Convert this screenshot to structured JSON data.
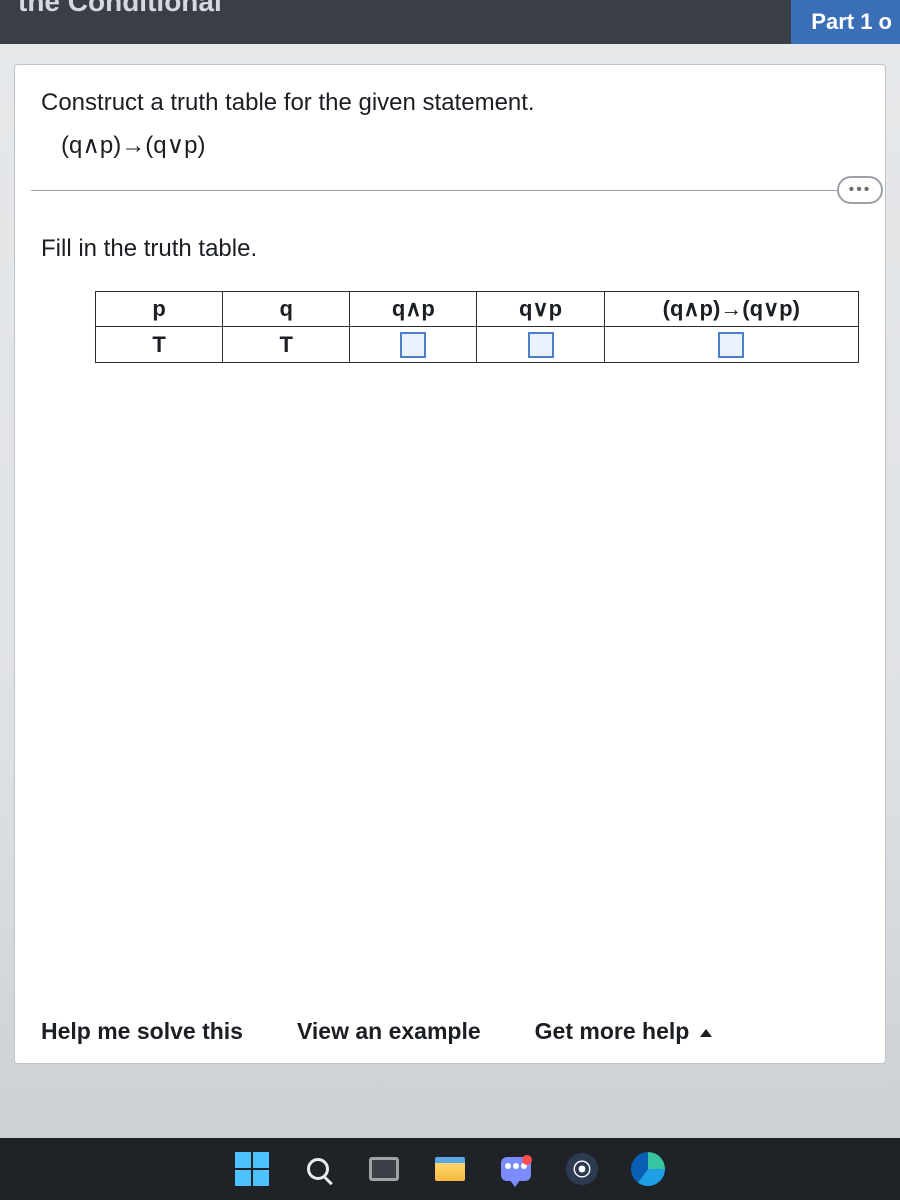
{
  "header": {
    "title": "the Conditional",
    "part": "Part 1 o"
  },
  "question": {
    "prompt": "Construct a truth table for the given statement.",
    "formula": "(q∧p)→(q∨p)",
    "more_label": "•••",
    "instruction": "Fill in the truth table."
  },
  "table": {
    "headers": [
      "p",
      "q",
      "q∧p",
      "q∨p",
      "(q∧p)→(q∨p)"
    ],
    "row": {
      "p": "T",
      "q": "T"
    }
  },
  "footer": {
    "help": "Help me solve this",
    "example": "View an example",
    "more_help": "Get more help"
  }
}
